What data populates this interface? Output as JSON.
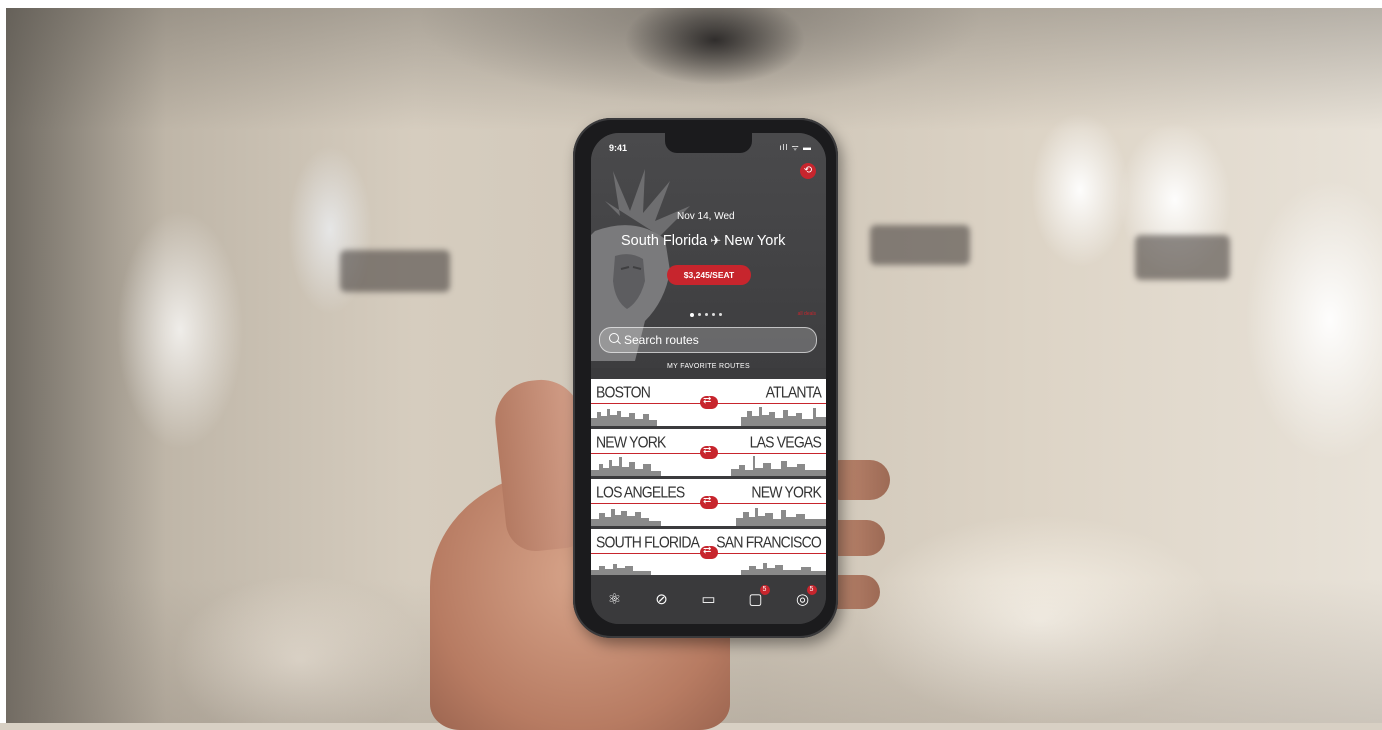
{
  "status_bar": {
    "time": "9:41",
    "icons": "ıll ᯤ ▬"
  },
  "hero": {
    "date": "Nov 14, Wed",
    "origin": "South Florida",
    "destination": "New York",
    "price": "$3,245/SEAT",
    "all_deals": "all deals"
  },
  "search": {
    "placeholder": "Search routes"
  },
  "favorites": {
    "header": "MY FAVORITE ROUTES",
    "routes": [
      {
        "from": "BOSTON",
        "to": "ATLANTA"
      },
      {
        "from": "NEW YORK",
        "to": "LAS VEGAS"
      },
      {
        "from": "LOS ANGELES",
        "to": "NEW YORK"
      },
      {
        "from": "SOUTH FLORIDA",
        "to": "SAN FRANCISCO"
      }
    ]
  },
  "tabbar": {
    "items": [
      {
        "icon": "atom-icon"
      },
      {
        "icon": "flight-icon"
      },
      {
        "icon": "briefcase-icon"
      },
      {
        "icon": "chat-icon",
        "badge": "5"
      },
      {
        "icon": "profile-icon",
        "badge": "5"
      }
    ]
  },
  "colors": {
    "accent": "#c7252d",
    "screen_bg": "#3b3b3d"
  }
}
